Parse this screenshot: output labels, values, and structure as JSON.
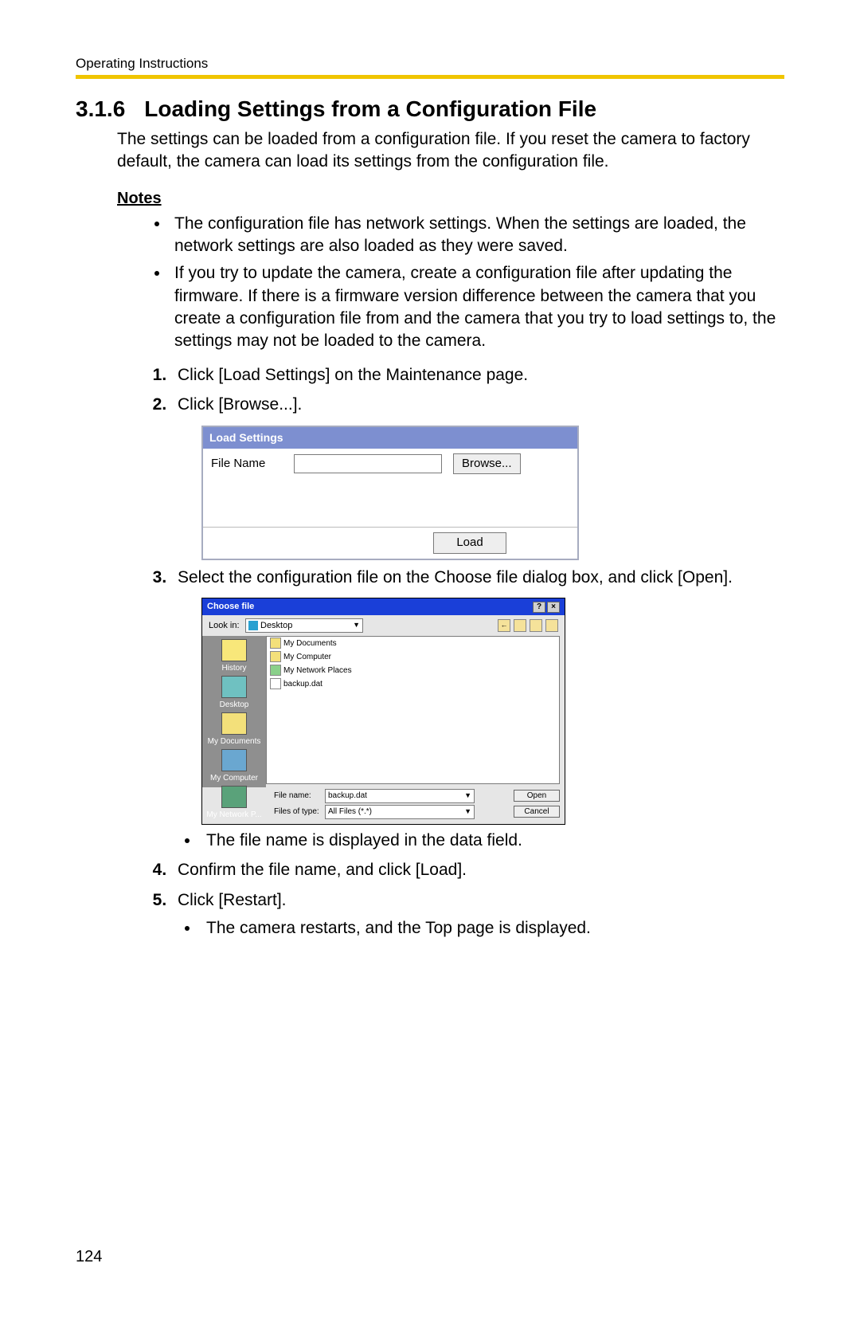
{
  "header": {
    "label": "Operating Instructions"
  },
  "section": {
    "number": "3.1.6",
    "title": "Loading Settings from a Configuration File"
  },
  "intro": "The settings can be loaded from a configuration file. If you reset the camera to factory default, the camera can load its settings from the configuration file.",
  "notes": {
    "title": "Notes",
    "items": [
      "The configuration file has network settings. When the settings are loaded, the network settings are also loaded as they were saved.",
      "If you try to update the camera, create a configuration file after updating the firmware. If there is a firmware version difference between the camera that you create a configuration file from and the camera that you try to load settings to, the settings may not be loaded to the camera."
    ]
  },
  "steps": {
    "s1": "Click [Load Settings] on the Maintenance page.",
    "s2": "Click [Browse...].",
    "s3": "Select the configuration file on the Choose file dialog box, and click [Open].",
    "s3_sub1": "The file name is displayed in the data field.",
    "s4": "Confirm the file name, and click [Load].",
    "s5": "Click [Restart].",
    "s5_sub1": "The camera restarts, and the Top page is displayed."
  },
  "panel1": {
    "bar": "Load Settings",
    "file_label": "File Name",
    "browse": "Browse...",
    "load": "Load"
  },
  "dialog": {
    "title": "Choose file",
    "lookin_label": "Look in:",
    "lookin_value": "Desktop",
    "back_tip": "←",
    "side": {
      "history": "History",
      "desktop": "Desktop",
      "mydocs": "My Documents",
      "mycomp": "My Computer",
      "mynet": "My Network P..."
    },
    "items": {
      "i1": "My Documents",
      "i2": "My Computer",
      "i3": "My Network Places",
      "i4": "backup.dat"
    },
    "filename_label": "File name:",
    "filename_value": "backup.dat",
    "filetype_label": "Files of type:",
    "filetype_value": "All Files (*.*)",
    "open": "Open",
    "cancel": "Cancel",
    "help_btn": "?",
    "close_btn": "×"
  },
  "page_number": "124"
}
